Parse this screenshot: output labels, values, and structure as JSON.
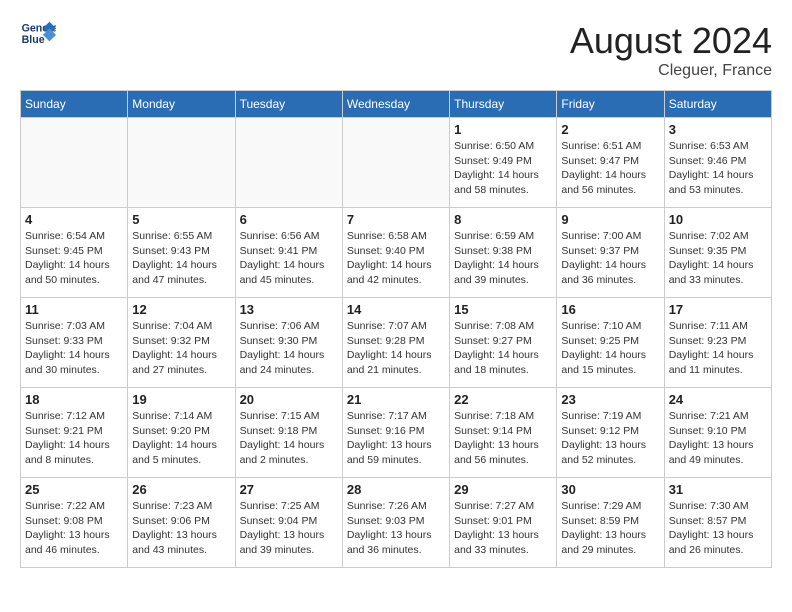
{
  "header": {
    "logo_text_top": "General",
    "logo_text_bottom": "Blue",
    "month_year": "August 2024",
    "location": "Cleguer, France"
  },
  "weekdays": [
    "Sunday",
    "Monday",
    "Tuesday",
    "Wednesday",
    "Thursday",
    "Friday",
    "Saturday"
  ],
  "weeks": [
    [
      {
        "day": "",
        "info": ""
      },
      {
        "day": "",
        "info": ""
      },
      {
        "day": "",
        "info": ""
      },
      {
        "day": "",
        "info": ""
      },
      {
        "day": "1",
        "info": "Sunrise: 6:50 AM\nSunset: 9:49 PM\nDaylight: 14 hours and 58 minutes."
      },
      {
        "day": "2",
        "info": "Sunrise: 6:51 AM\nSunset: 9:47 PM\nDaylight: 14 hours and 56 minutes."
      },
      {
        "day": "3",
        "info": "Sunrise: 6:53 AM\nSunset: 9:46 PM\nDaylight: 14 hours and 53 minutes."
      }
    ],
    [
      {
        "day": "4",
        "info": "Sunrise: 6:54 AM\nSunset: 9:45 PM\nDaylight: 14 hours and 50 minutes."
      },
      {
        "day": "5",
        "info": "Sunrise: 6:55 AM\nSunset: 9:43 PM\nDaylight: 14 hours and 47 minutes."
      },
      {
        "day": "6",
        "info": "Sunrise: 6:56 AM\nSunset: 9:41 PM\nDaylight: 14 hours and 45 minutes."
      },
      {
        "day": "7",
        "info": "Sunrise: 6:58 AM\nSunset: 9:40 PM\nDaylight: 14 hours and 42 minutes."
      },
      {
        "day": "8",
        "info": "Sunrise: 6:59 AM\nSunset: 9:38 PM\nDaylight: 14 hours and 39 minutes."
      },
      {
        "day": "9",
        "info": "Sunrise: 7:00 AM\nSunset: 9:37 PM\nDaylight: 14 hours and 36 minutes."
      },
      {
        "day": "10",
        "info": "Sunrise: 7:02 AM\nSunset: 9:35 PM\nDaylight: 14 hours and 33 minutes."
      }
    ],
    [
      {
        "day": "11",
        "info": "Sunrise: 7:03 AM\nSunset: 9:33 PM\nDaylight: 14 hours and 30 minutes."
      },
      {
        "day": "12",
        "info": "Sunrise: 7:04 AM\nSunset: 9:32 PM\nDaylight: 14 hours and 27 minutes."
      },
      {
        "day": "13",
        "info": "Sunrise: 7:06 AM\nSunset: 9:30 PM\nDaylight: 14 hours and 24 minutes."
      },
      {
        "day": "14",
        "info": "Sunrise: 7:07 AM\nSunset: 9:28 PM\nDaylight: 14 hours and 21 minutes."
      },
      {
        "day": "15",
        "info": "Sunrise: 7:08 AM\nSunset: 9:27 PM\nDaylight: 14 hours and 18 minutes."
      },
      {
        "day": "16",
        "info": "Sunrise: 7:10 AM\nSunset: 9:25 PM\nDaylight: 14 hours and 15 minutes."
      },
      {
        "day": "17",
        "info": "Sunrise: 7:11 AM\nSunset: 9:23 PM\nDaylight: 14 hours and 11 minutes."
      }
    ],
    [
      {
        "day": "18",
        "info": "Sunrise: 7:12 AM\nSunset: 9:21 PM\nDaylight: 14 hours and 8 minutes."
      },
      {
        "day": "19",
        "info": "Sunrise: 7:14 AM\nSunset: 9:20 PM\nDaylight: 14 hours and 5 minutes."
      },
      {
        "day": "20",
        "info": "Sunrise: 7:15 AM\nSunset: 9:18 PM\nDaylight: 14 hours and 2 minutes."
      },
      {
        "day": "21",
        "info": "Sunrise: 7:17 AM\nSunset: 9:16 PM\nDaylight: 13 hours and 59 minutes."
      },
      {
        "day": "22",
        "info": "Sunrise: 7:18 AM\nSunset: 9:14 PM\nDaylight: 13 hours and 56 minutes."
      },
      {
        "day": "23",
        "info": "Sunrise: 7:19 AM\nSunset: 9:12 PM\nDaylight: 13 hours and 52 minutes."
      },
      {
        "day": "24",
        "info": "Sunrise: 7:21 AM\nSunset: 9:10 PM\nDaylight: 13 hours and 49 minutes."
      }
    ],
    [
      {
        "day": "25",
        "info": "Sunrise: 7:22 AM\nSunset: 9:08 PM\nDaylight: 13 hours and 46 minutes."
      },
      {
        "day": "26",
        "info": "Sunrise: 7:23 AM\nSunset: 9:06 PM\nDaylight: 13 hours and 43 minutes."
      },
      {
        "day": "27",
        "info": "Sunrise: 7:25 AM\nSunset: 9:04 PM\nDaylight: 13 hours and 39 minutes."
      },
      {
        "day": "28",
        "info": "Sunrise: 7:26 AM\nSunset: 9:03 PM\nDaylight: 13 hours and 36 minutes."
      },
      {
        "day": "29",
        "info": "Sunrise: 7:27 AM\nSunset: 9:01 PM\nDaylight: 13 hours and 33 minutes."
      },
      {
        "day": "30",
        "info": "Sunrise: 7:29 AM\nSunset: 8:59 PM\nDaylight: 13 hours and 29 minutes."
      },
      {
        "day": "31",
        "info": "Sunrise: 7:30 AM\nSunset: 8:57 PM\nDaylight: 13 hours and 26 minutes."
      }
    ]
  ]
}
